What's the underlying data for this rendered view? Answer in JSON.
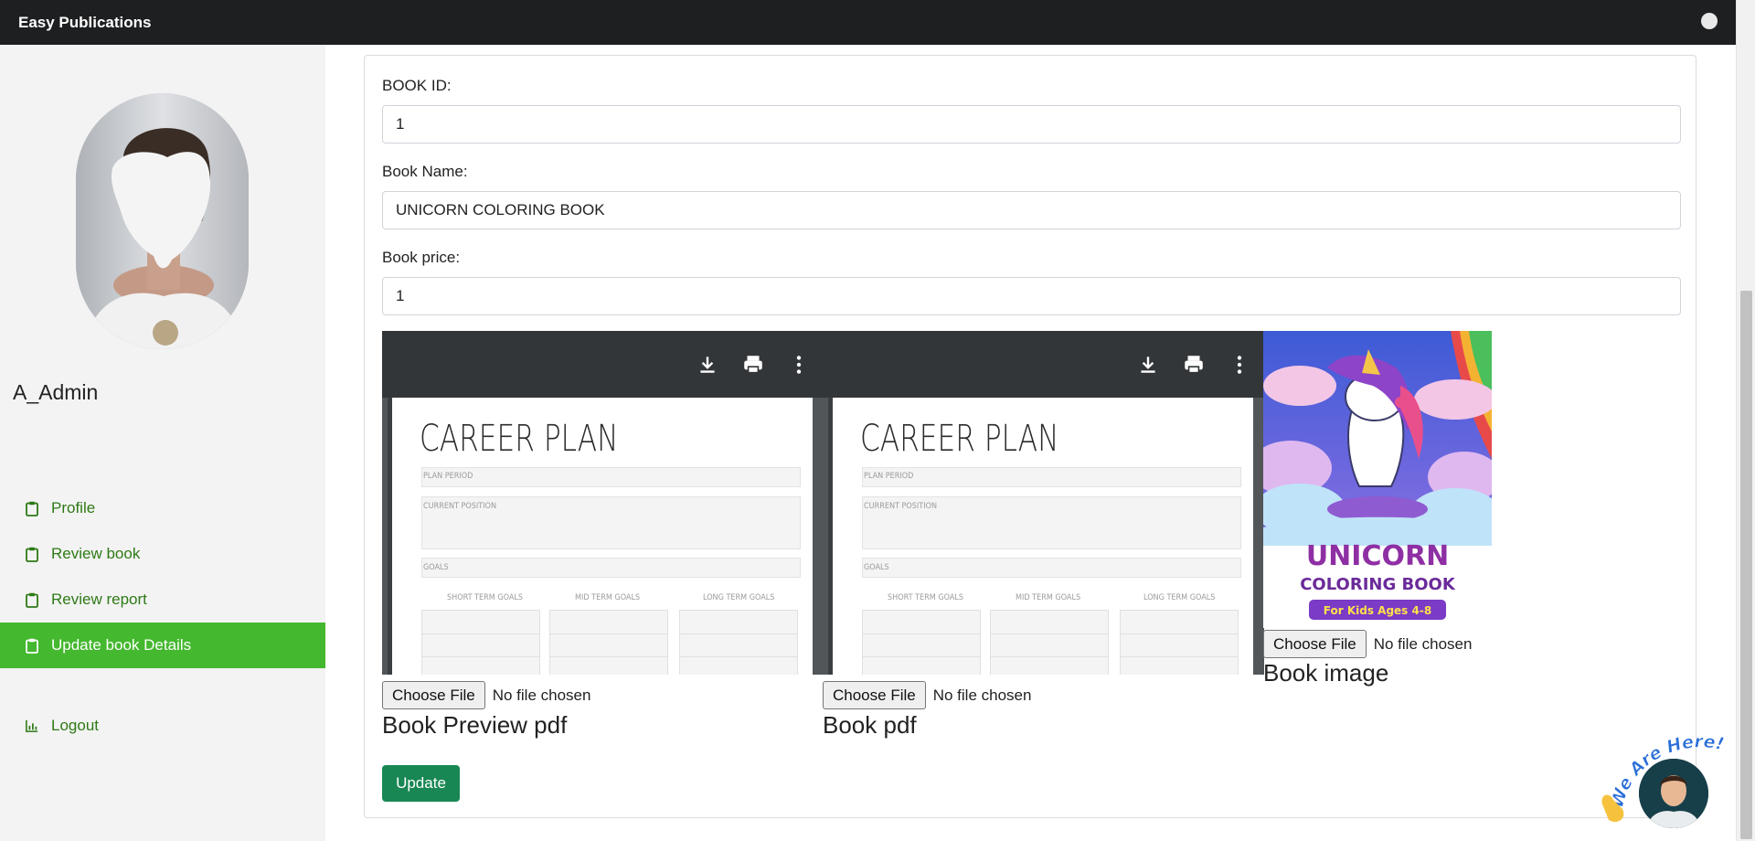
{
  "navbar": {
    "brand": "Easy Publications"
  },
  "sidebar": {
    "user_name": "A_Admin",
    "menu": [
      {
        "label": "Profile",
        "icon": "clipboard-icon"
      },
      {
        "label": "Review book",
        "icon": "clipboard-icon"
      },
      {
        "label": "Review report",
        "icon": "clipboard-icon"
      },
      {
        "label": "Update book Details",
        "icon": "clipboard-icon",
        "active": true
      },
      {
        "label": "Logout",
        "icon": "bar-chart-icon"
      }
    ]
  },
  "form": {
    "book_id": {
      "label": "BOOK ID:",
      "value": "1"
    },
    "book_name": {
      "label": "Book Name:",
      "value": "UNICORN COLORING BOOK"
    },
    "book_price": {
      "label": "Book price:",
      "value": "1"
    },
    "uploads": {
      "choose_file_label": "Choose File",
      "no_file_text": "No file chosen",
      "preview_pdf_label": "Book Preview pdf",
      "pdf_label": "Book pdf",
      "image_label": "Book image"
    },
    "update_label": "Update"
  },
  "pdf_preview": {
    "title": "CAREER PLAN",
    "plan_period": "PLAN PERIOD",
    "current_position": "CURRENT POSITION",
    "goals": "GOALS",
    "short_term": "SHORT TERM GOALS",
    "mid_term": "MID TERM GOALS",
    "long_term": "LONG TERM GOALS"
  },
  "book_cover": {
    "line1": "UNICORN",
    "line2": "COLORING BOOK",
    "line3": "For Kids Ages 4-8"
  },
  "chat_widget": {
    "text": "We Are Here!"
  },
  "colors": {
    "navbar": "#1e1f21",
    "active_menu": "#44b82e",
    "menu_text": "#2e7a16",
    "update_button": "#198754"
  }
}
